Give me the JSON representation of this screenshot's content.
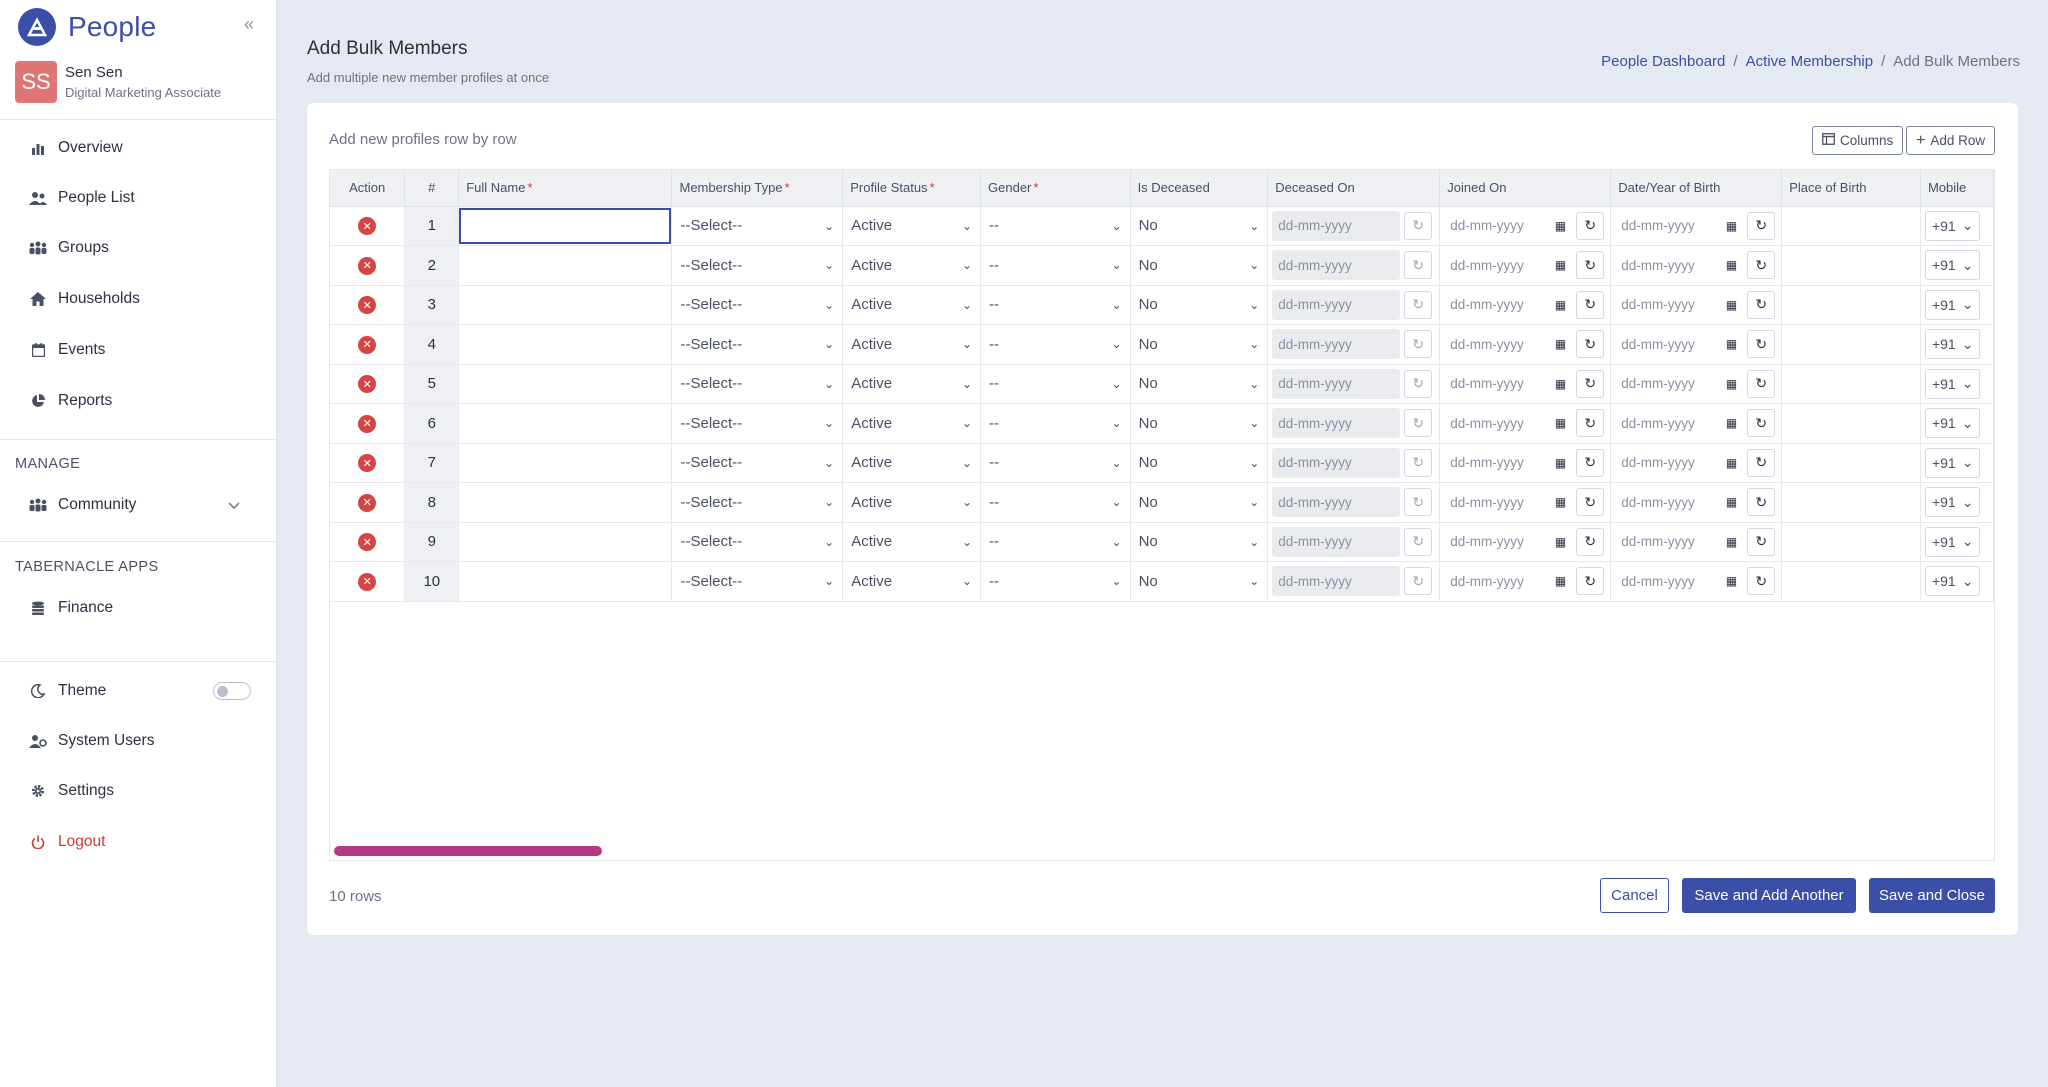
{
  "app": {
    "brand": "People",
    "collapse_glyph": "«"
  },
  "user": {
    "initials": "SS",
    "name": "Sen Sen",
    "role": "Digital Marketing Associate"
  },
  "nav": [
    {
      "label": "Overview",
      "icon": "bar-chart-icon"
    },
    {
      "label": "People List",
      "icon": "people-icon"
    },
    {
      "label": "Groups",
      "icon": "groups-icon"
    },
    {
      "label": "Households",
      "icon": "home-icon"
    },
    {
      "label": "Events",
      "icon": "calendar-icon"
    },
    {
      "label": "Reports",
      "icon": "pie-chart-icon"
    }
  ],
  "manage": {
    "title": "MANAGE",
    "community": "Community"
  },
  "apps": {
    "title": "TABERNACLE APPS",
    "finance": "Finance"
  },
  "bottom": {
    "theme": "Theme",
    "system_users": "System Users",
    "settings": "Settings",
    "logout": "Logout"
  },
  "header": {
    "title": "Add Bulk Members",
    "subtitle": "Add multiple new member profiles at once",
    "breadcrumb": [
      "People Dashboard",
      "Active Membership",
      "Add Bulk Members"
    ]
  },
  "card": {
    "title": "Add new profiles row by row",
    "columns_button": "Columns",
    "add_row_button": "Add Row"
  },
  "table": {
    "headers": {
      "action": "Action",
      "num": "#",
      "full_name": "Full Name",
      "membership_type": "Membership Type",
      "profile_status": "Profile Status",
      "gender": "Gender",
      "is_deceased": "Is Deceased",
      "deceased_on": "Deceased On",
      "joined_on": "Joined On",
      "dob": "Date/Year of Birth",
      "place_of_birth": "Place of Birth",
      "mobile": "Mobile"
    },
    "required_marker": "*",
    "defaults": {
      "membership_type": "--Select--",
      "profile_status": "Active",
      "gender": "--",
      "is_deceased": "No",
      "date_placeholder": "dd-mm-yyyy",
      "mobile_code": "+91"
    },
    "rows": [
      1,
      2,
      3,
      4,
      5,
      6,
      7,
      8,
      9,
      10
    ]
  },
  "footer": {
    "row_count": "10 rows",
    "cancel": "Cancel",
    "save_add_another": "Save and Add Another",
    "save_close": "Save and Close"
  },
  "colors": {
    "primary": "#3b4ea8",
    "danger": "#d64545",
    "scrollbar": "#b63883",
    "avatar": "#e07575"
  }
}
